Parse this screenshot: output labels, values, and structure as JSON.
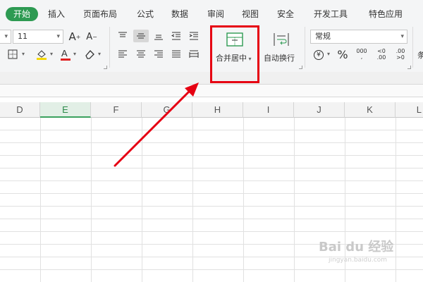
{
  "tabs": [
    {
      "label": "开始",
      "active": true
    },
    {
      "label": "插入"
    },
    {
      "label": "页面布局"
    },
    {
      "label": "公式"
    },
    {
      "label": "数据"
    },
    {
      "label": "审阅"
    },
    {
      "label": "视图"
    },
    {
      "label": "安全"
    },
    {
      "label": "开发工具"
    },
    {
      "label": "特色应用"
    }
  ],
  "font": {
    "size": "11"
  },
  "alignment": {
    "merge_center_label": "合并居中",
    "wrap_text_label": "自动换行"
  },
  "number": {
    "format": "常规",
    "currency_symbol": "¥",
    "percent_symbol": "%",
    "thousands_label": "000",
    "inc_decimal_label": ".00",
    "dec_decimal_label": ".00"
  },
  "columns": [
    "D",
    "E",
    "F",
    "G",
    "H",
    "I",
    "J",
    "K",
    "L"
  ],
  "selected_column": "E",
  "watermark": {
    "brand": "Bai du 经验",
    "url": "jingyan.baidu.com"
  },
  "colors": {
    "accent": "#2d9a52",
    "annotation": "#e60012"
  }
}
